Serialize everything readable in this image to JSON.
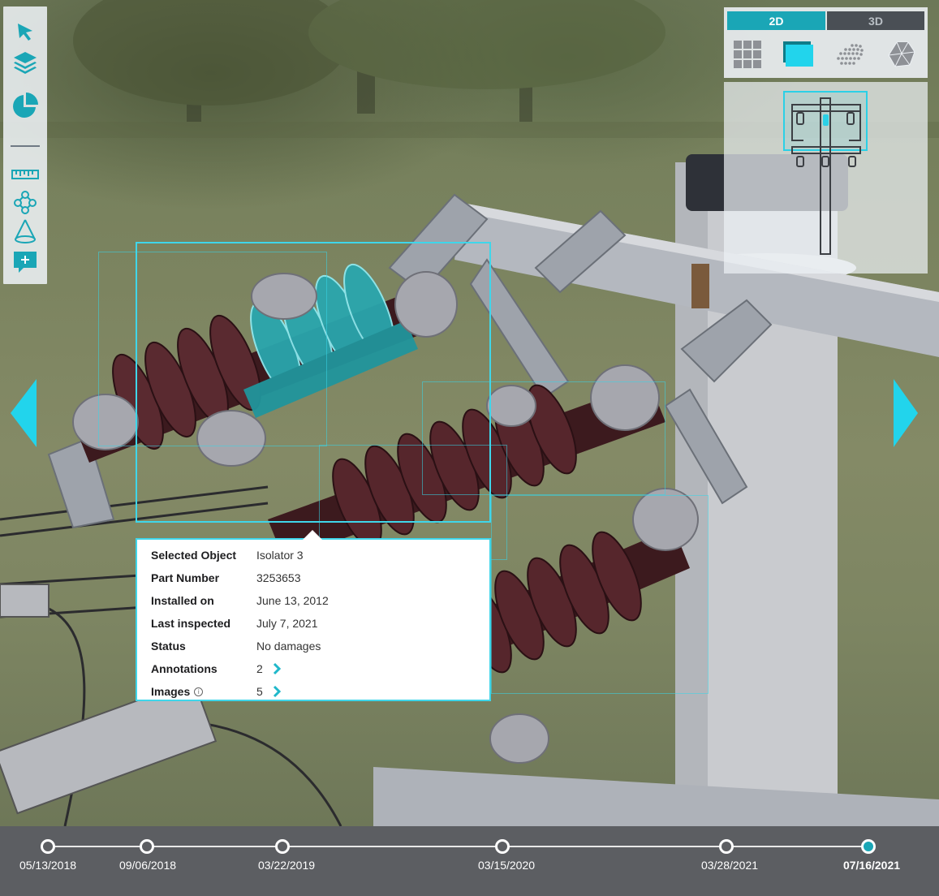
{
  "toolbar": {
    "tools": [
      {
        "name": "select-pointer-icon"
      },
      {
        "name": "layers-icon"
      },
      {
        "name": "pie-chart-icon"
      },
      {
        "name": "ruler-icon"
      },
      {
        "name": "network-nodes-icon"
      },
      {
        "name": "cone-icon"
      },
      {
        "name": "add-comment-icon"
      }
    ]
  },
  "view_panel": {
    "mode_2d_label": "2D",
    "mode_3d_label": "3D",
    "active_mode": "2D",
    "view_icons": [
      "grid-tiles-icon",
      "stacked-layers-icon",
      "point-cloud-icon",
      "mesh-icon"
    ],
    "active_view_icon": "stacked-layers-icon"
  },
  "info_panel": {
    "rows": [
      {
        "key": "Selected Object",
        "value": "Isolator 3"
      },
      {
        "key": "Part Number",
        "value": "3253653"
      },
      {
        "key": "Installed on",
        "value": "June 13, 2012"
      },
      {
        "key": "Last inspected",
        "value": "July 7, 2021"
      },
      {
        "key": "Status",
        "value": "No damages"
      },
      {
        "key": "Annotations",
        "value": "2"
      },
      {
        "key": "Images",
        "value": "5"
      }
    ]
  },
  "timeline": {
    "dates": [
      "05/13/2018",
      "09/06/2018",
      "03/22/2019",
      "03/15/2020",
      "03/28/2021",
      "07/16/2021"
    ],
    "active": "07/16/2021"
  },
  "colors": {
    "accent": "#1aa6b6",
    "highlight": "#3fd6ea",
    "timeline_bg": "#5c5e62",
    "toolbar_bg": "#ecf0f4"
  }
}
